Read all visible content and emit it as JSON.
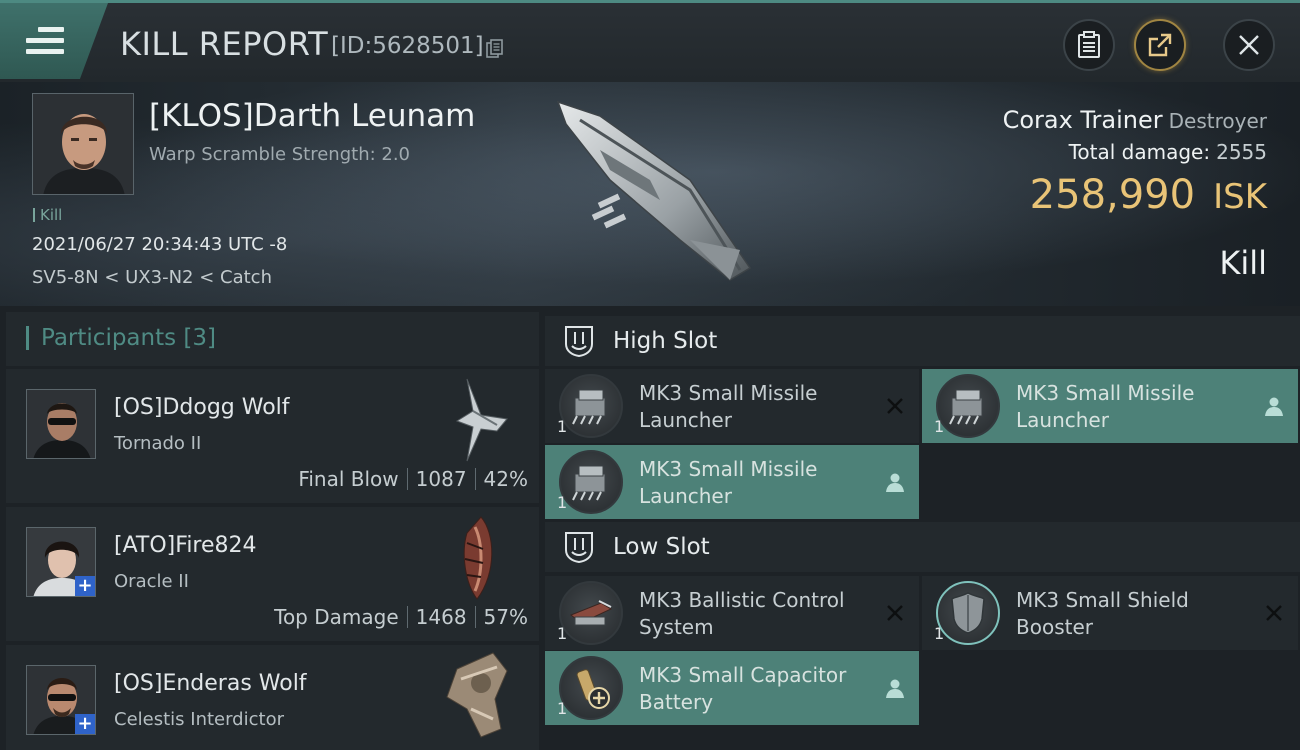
{
  "header": {
    "title": "KILL REPORT",
    "report_id": "[ID:5628501]",
    "icons": [
      "menu-icon",
      "copy-icon",
      "clipboard-icon",
      "share-icon",
      "close-icon"
    ]
  },
  "victim": {
    "name": "[KLOS]Darth Leunam",
    "warp_scramble": "Warp Scramble Strength: 2.0",
    "tag": "Kill",
    "timestamp": "2021/06/27 20:34:43 UTC -8",
    "location": "SV5-8N < UX3-N2 < Catch",
    "ship_name": "Corax Trainer",
    "ship_class": "Destroyer",
    "total_damage_label": "Total damage:",
    "total_damage": "2555",
    "isk_value": "258,990",
    "isk_unit": "ISK",
    "result": "Kill"
  },
  "participants": {
    "title": "Participants",
    "count": "[3]",
    "items": [
      {
        "name": "[OS]Ddogg Wolf",
        "ship": "Tornado II",
        "role": "Final Blow",
        "damage": "1087",
        "percent": "42%",
        "plus": ""
      },
      {
        "name": "[ATO]Fire824",
        "ship": "Oracle II",
        "role": "Top Damage",
        "damage": "1468",
        "percent": "57%",
        "plus": "+"
      },
      {
        "name": "[OS]Enderas Wolf",
        "ship": "Celestis Interdictor",
        "role": "",
        "damage": "",
        "percent": "",
        "plus": "+"
      }
    ]
  },
  "slots": {
    "high": {
      "title": "High Slot",
      "modules": [
        {
          "name": "MK3 Small Missile Launcher",
          "qty": "1",
          "state": "destroyed"
        },
        {
          "name": "MK3 Small Missile Launcher",
          "qty": "1",
          "state": "dropped"
        },
        {
          "name": "MK3 Small Missile Launcher",
          "qty": "1",
          "state": "dropped"
        }
      ]
    },
    "low": {
      "title": "Low Slot",
      "modules": [
        {
          "name": "MK3 Ballistic Control System",
          "qty": "1",
          "state": "destroyed"
        },
        {
          "name": "MK3 Small Shield Booster",
          "qty": "1",
          "state": "destroyed"
        },
        {
          "name": "MK3 Small Capacitor Battery",
          "qty": "1",
          "state": "dropped"
        }
      ]
    }
  },
  "colors": {
    "accent": "#4f8b84",
    "dropped_bg": "#4d8178",
    "isk": "#e9c477",
    "panel": "#23292d"
  }
}
